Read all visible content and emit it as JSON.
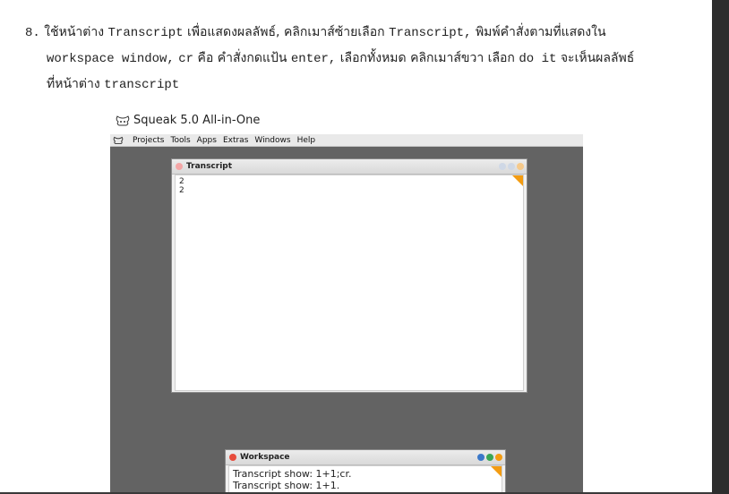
{
  "instruction": {
    "line1_num": "8.",
    "line1_a": "ใช้หน้าต่าง",
    "line1_code1": "Transcript",
    "line1_b": "เพื่อแสดงผลลัพธ์,",
    "line1_c": "คลิกเมาส์ซ้ายเลือก",
    "line1_code2": "Transcript,",
    "line1_d": "พิมพ์คำสั่งตามที่แสดงใน",
    "line2_code1": "workspace window,",
    "line2_code2": "cr",
    "line2_a": "คือ คำสั่งกดแป้น",
    "line2_code3": "enter,",
    "line2_b": "เลือกทั้งหมด คลิกเมาส์ขวา เลือก",
    "line2_code4": "do it",
    "line2_c": "จะเห็นผลลัพธ์",
    "line3_a": "ที่หน้าต่าง",
    "line3_code": "transcript"
  },
  "app": {
    "title": "Squeak 5.0 All-in-One"
  },
  "menubar": {
    "items": [
      "Projects",
      "Tools",
      "Apps",
      "Extras",
      "Windows",
      "Help"
    ]
  },
  "transcript_window": {
    "title": "Transcript",
    "lines": [
      "2",
      "2"
    ]
  },
  "workspace_window": {
    "title": "Workspace",
    "lines": [
      "Transcript show: 1+1;cr.",
      "Transcript show: 1+1."
    ]
  },
  "colors": {
    "desktop": "#636363",
    "close_red": "#e74c3c",
    "corner_orange": "#f39c12",
    "btn_blue": "#3b78c9",
    "btn_green": "#3aa655",
    "btn_orange": "#f39c12"
  }
}
